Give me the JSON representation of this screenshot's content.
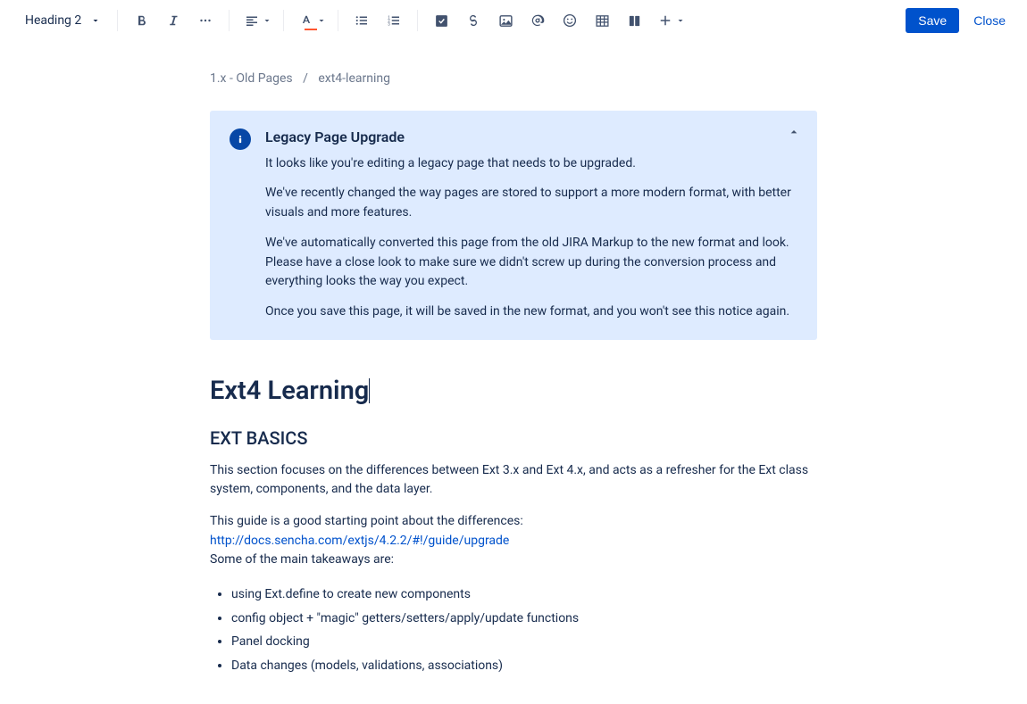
{
  "toolbar": {
    "text_style": "Heading 2",
    "save_label": "Save",
    "close_label": "Close"
  },
  "breadcrumb": {
    "parent": "1.x - Old Pages",
    "current": "ext4-learning"
  },
  "notice": {
    "title": "Legacy Page Upgrade",
    "p1": "It looks like you're editing a legacy page that needs to be upgraded.",
    "p2": "We've recently changed the way pages are stored to support a more modern format, with better visuals and more features.",
    "p3": "We've automatically converted this page from the old JIRA Markup to the new format and look. Please have a close look to make sure we didn't screw up during the conversion process and everything looks the way you expect.",
    "p4": "Once you save this page, it will be saved in the new format, and you won't see this notice again."
  },
  "doc": {
    "title": "Ext4 Learning",
    "section1": "EXT BASICS",
    "para1": "This section focuses on the differences between Ext 3.x and Ext 4.x, and acts as a refresher for the Ext class system, components, and the data layer.",
    "para2a": "This guide is a good starting point about the differences:",
    "link": "http://docs.sencha.com/extjs/4.2.2/#!/guide/upgrade",
    "para2b": "Some of the main takeaways are:",
    "bullets": [
      "using Ext.define to create new components",
      "config object + \"magic\" getters/setters/apply/update functions",
      "Panel docking",
      "Data changes (models, validations, associations)"
    ]
  }
}
